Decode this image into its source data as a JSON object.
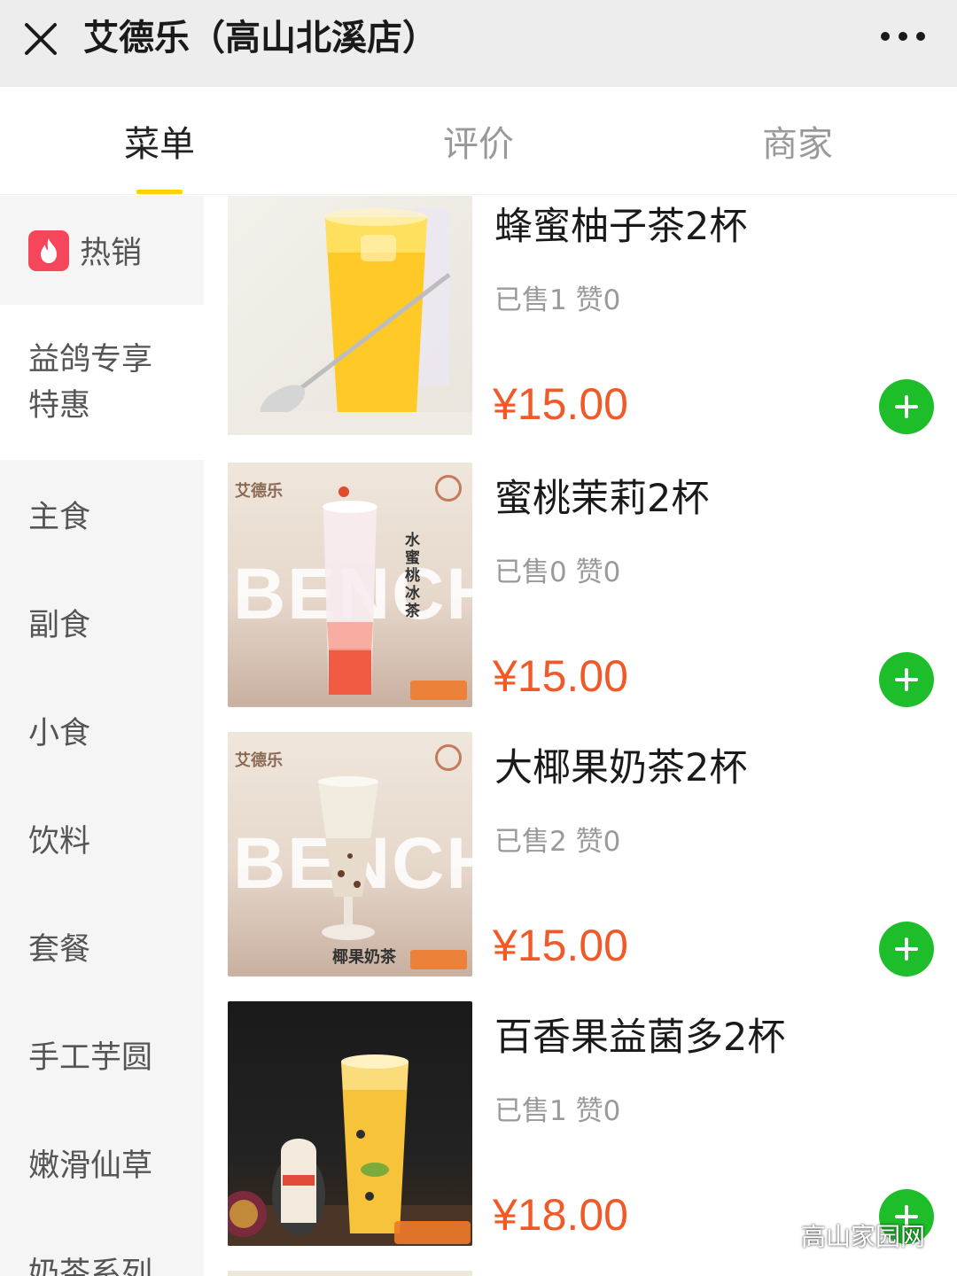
{
  "header": {
    "title": "艾德乐（高山北溪店）",
    "close_icon": "close-icon",
    "more_icon": "more-dots-icon"
  },
  "tabs": [
    {
      "label": "菜单",
      "active": true
    },
    {
      "label": "评价",
      "active": false
    },
    {
      "label": "商家",
      "active": false
    }
  ],
  "sidebar": {
    "hot": {
      "label": "热销",
      "icon": "flame-icon"
    },
    "categories": [
      {
        "label": "益鸽专享\n特惠",
        "selected": true
      },
      {
        "label": "主食"
      },
      {
        "label": "副食"
      },
      {
        "label": "小食"
      },
      {
        "label": "饮料"
      },
      {
        "label": "套餐"
      },
      {
        "label": "手工芋圆"
      },
      {
        "label": "嫩滑仙草"
      },
      {
        "label": "奶茶系列"
      }
    ]
  },
  "items": [
    {
      "name": "蜂蜜柚子茶2杯",
      "sold": "已售1 赞0",
      "price": "¥15.00"
    },
    {
      "name": "蜜桃茉莉2杯",
      "sold": "已售0 赞0",
      "price": "¥15.00",
      "image_logo": "艾德乐",
      "image_text": "BENCH",
      "image_vertical": "水蜜桃冰茶"
    },
    {
      "name": "大椰果奶茶2杯",
      "sold": "已售2 赞0",
      "price": "¥15.00",
      "image_logo": "艾德乐",
      "image_text": "BENCH",
      "image_caption": "椰果奶茶"
    },
    {
      "name": "百香果益菌多2杯",
      "sold": "已售1 赞0",
      "price": "¥18.00"
    }
  ],
  "watermark": {
    "text": "高山家园网"
  },
  "colors": {
    "accent_yellow": "#ffd200",
    "price_orange": "#f05a28",
    "add_green": "#1ebd2a",
    "hot_red": "#f5465b"
  }
}
